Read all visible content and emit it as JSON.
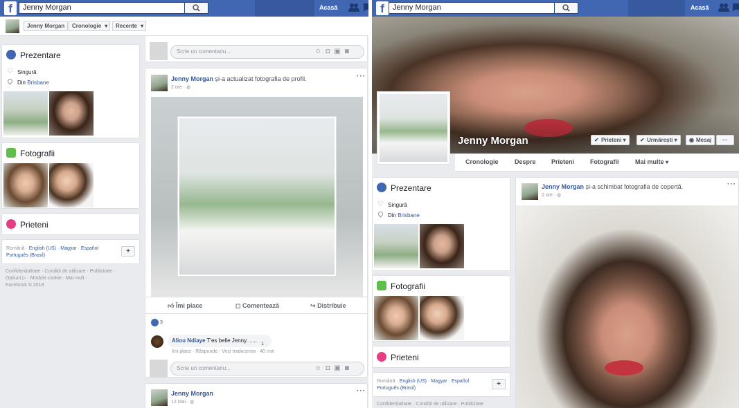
{
  "left": {
    "search": {
      "value": "Jenny Morgan"
    },
    "nav": {
      "home": "Acasă"
    },
    "subnav": {
      "name": "Jenny Morgan",
      "timeline": "Cronologie",
      "recent": "Recente"
    },
    "intro": {
      "title": "Prezentare",
      "relationship": "Singură",
      "from_prefix": "Din",
      "from_city": "Brisbane"
    },
    "photos_title": "Fotografii",
    "friends_title": "Prieteni",
    "languages": {
      "items": [
        "Română",
        "English (US)",
        "Magyar",
        "Español"
      ],
      "more": "Português (Brasil)",
      "add": "+"
    },
    "footer": {
      "line1": "Confidențialitate · Condiții de utilizare · Publicitate ·",
      "line2": "Opțiuni ▷ · Module cookie · Mai mult ·",
      "line3": "Facebook © 2018"
    },
    "comment_placeholder": "Scrie un comentariu...",
    "post1": {
      "name": "Jenny Morgan",
      "action": "și-a actualizat fotografia de profil.",
      "time": "2 ore",
      "like": "Îmi place",
      "comment": "Comentează",
      "share": "Distribuie",
      "reactions": "3"
    },
    "comment1": {
      "author": "Aliou Ndiaye",
      "text": "T'es belle Jenny. .....",
      "likes": "1",
      "actions": "Îmi place · Răspunde · Vezi traducerea · 40 min"
    },
    "post2": {
      "name": "Jenny Morgan",
      "time": "12 Mai"
    }
  },
  "right": {
    "search": {
      "value": "Jenny Morgan"
    },
    "nav": {
      "home": "Acasă"
    },
    "profile": {
      "name": "Jenny Morgan"
    },
    "buttons": {
      "friends": "Prieteni",
      "follow": "Urmărești",
      "message": "Mesaj",
      "more": "···"
    },
    "tabs": [
      "Cronologie",
      "Despre",
      "Prieteni",
      "Fotografii",
      "Mai multe"
    ],
    "intro": {
      "title": "Prezentare",
      "relationship": "Singură",
      "from_prefix": "Din",
      "from_city": "Brisbane"
    },
    "photos_title": "Fotografii",
    "friends_title": "Prieteni",
    "languages": {
      "items": [
        "Română",
        "English (US)",
        "Magyar",
        "Español"
      ],
      "more": "Português (Brasil)",
      "add": "+"
    },
    "footer": {
      "line1": "Confidențialitate · Condiții de utilizare · Publicitate"
    },
    "post": {
      "name": "Jenny Morgan",
      "action": "și-a schimbat fotografia de copertă.",
      "time": "2 ore"
    }
  },
  "colors": {
    "brand": "#4267b2",
    "link": "#365899",
    "background": "#e9ebee",
    "prezentare": "#4267b2",
    "fotografii": "#5fbf4a",
    "prieteni": "#e63e82"
  }
}
